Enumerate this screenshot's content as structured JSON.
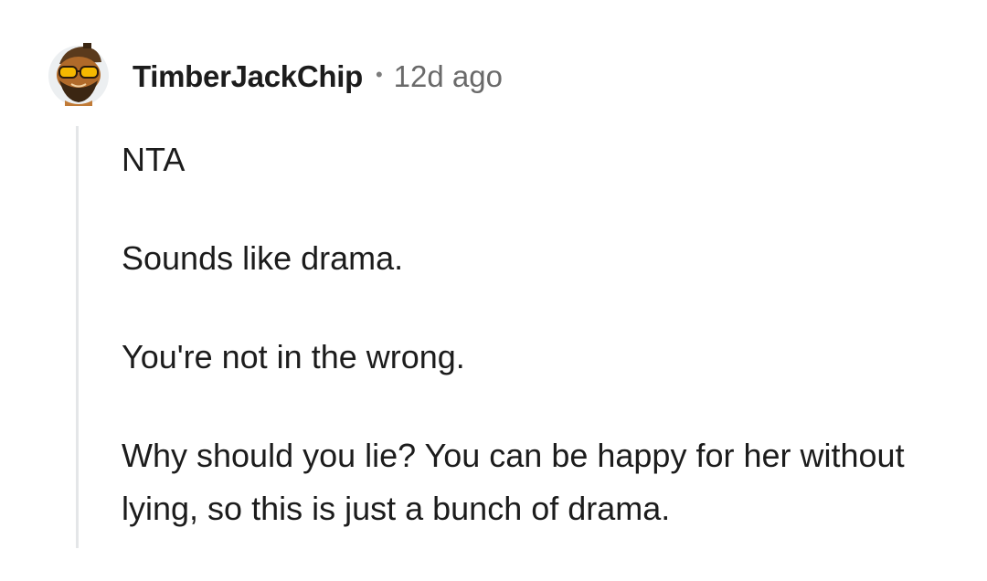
{
  "comment": {
    "author": "TimberJackChip",
    "separator": "•",
    "timestamp": "12d ago",
    "avatar_icon": "bearded-snoo-avatar-icon",
    "paragraphs": [
      "NTA",
      "Sounds like drama.",
      "You're not in the wrong.",
      "Why should you lie? You can be happy for her without lying, so this is just a bunch of drama."
    ]
  },
  "colors": {
    "text": "#1c1c1c",
    "meta": "#6a6a6a",
    "thread_line": "#e4e6e8",
    "avatar_skin": "#b06a2a",
    "avatar_glasses": "#f5b800"
  }
}
